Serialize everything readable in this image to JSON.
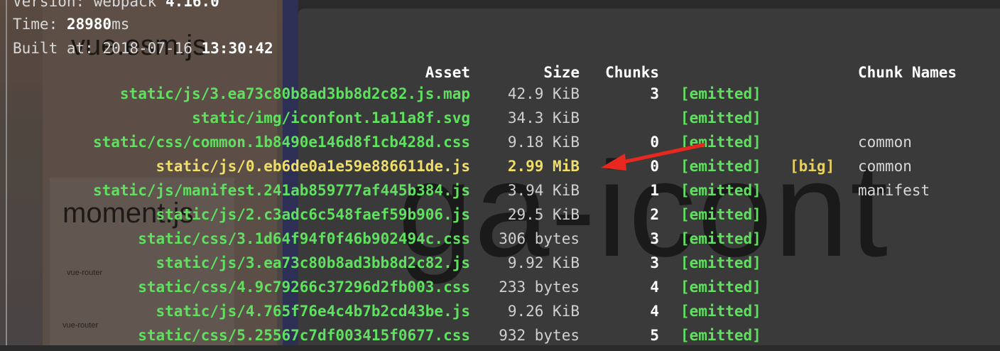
{
  "header": {
    "version_label": "Version: webpack ",
    "version_value": "4.16.0",
    "time_label": "Time: ",
    "time_value": "28980",
    "time_unit": "ms",
    "built_label": "Built at: 2018-07-16 ",
    "built_value": "13:30:42"
  },
  "columns": {
    "asset": "Asset",
    "size": "Size",
    "chunks": "Chunks",
    "chunk_names": "Chunk Names"
  },
  "rows": [
    {
      "asset": "static/js/3.ea73c80b8ad3bb8d2c82.js.map",
      "size": "42.9 KiB",
      "chunks": "3",
      "emitted": "[emitted]",
      "flag": "",
      "names": "",
      "color": "green"
    },
    {
      "asset": "static/img/iconfont.1a11a8f.svg",
      "size": "34.3 KiB",
      "chunks": "",
      "emitted": "[emitted]",
      "flag": "",
      "names": "",
      "color": "green"
    },
    {
      "asset": "static/css/common.1b8490e146d8f1cb428d.css",
      "size": "9.18 KiB",
      "chunks": "0",
      "emitted": "[emitted]",
      "flag": "",
      "names": "common",
      "color": "green"
    },
    {
      "asset": "static/js/0.eb6de0a1e59e886611de.js",
      "size": "2.99 MiB",
      "chunks": "0",
      "emitted": "[emitted]",
      "flag": "[big]",
      "names": "common",
      "color": "yellow"
    },
    {
      "asset": "static/js/manifest.241ab859777af445b384.js",
      "size": "3.94 KiB",
      "chunks": "1",
      "emitted": "[emitted]",
      "flag": "",
      "names": "manifest",
      "color": "green"
    },
    {
      "asset": "static/js/2.c3adc6c548faef59b906.js",
      "size": "29.5 KiB",
      "chunks": "2",
      "emitted": "[emitted]",
      "flag": "",
      "names": "",
      "color": "green"
    },
    {
      "asset": "static/css/3.1d64f94f0f46b902494c.css",
      "size": "306 bytes",
      "chunks": "3",
      "emitted": "[emitted]",
      "flag": "",
      "names": "",
      "color": "green"
    },
    {
      "asset": "static/js/3.ea73c80b8ad3bb8d2c82.js",
      "size": "9.92 KiB",
      "chunks": "3",
      "emitted": "[emitted]",
      "flag": "",
      "names": "",
      "color": "green"
    },
    {
      "asset": "static/css/4.9c79266c37296d2fb003.css",
      "size": "233 bytes",
      "chunks": "4",
      "emitted": "[emitted]",
      "flag": "",
      "names": "",
      "color": "green"
    },
    {
      "asset": "static/js/4.765f76e4c4b7b2cd43be.js",
      "size": "9.26 KiB",
      "chunks": "4",
      "emitted": "[emitted]",
      "flag": "",
      "names": "",
      "color": "green"
    },
    {
      "asset": "static/css/5.25567c7df003415f0677.css",
      "size": "932 bytes",
      "chunks": "5",
      "emitted": "[emitted]",
      "flag": "",
      "names": "",
      "color": "green"
    }
  ],
  "overlay": {
    "big_text": "ga-icont",
    "vue_label": "vue.esm.js",
    "moment_label": "moment.js",
    "router_label_1": "vue-router",
    "router_label_2": "vue-router"
  },
  "colors": {
    "emitted": "#5fe05f",
    "big_asset": "#f0de6a",
    "arrow": "#e8281e"
  },
  "annotation": {
    "arrow_icon": "red-arrow-icon"
  }
}
